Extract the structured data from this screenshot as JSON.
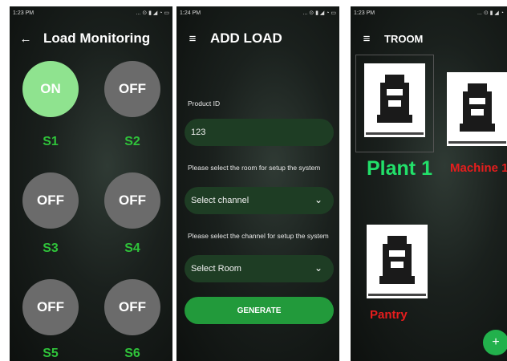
{
  "screen1": {
    "status_time": "1:23 PM",
    "status_icons": "... ⊙ ▮ ◢ ◔ ▭",
    "title": "Load Monitoring",
    "switches": [
      {
        "state": "ON",
        "label": "S1"
      },
      {
        "state": "OFF",
        "label": "S2"
      },
      {
        "state": "OFF",
        "label": "S3"
      },
      {
        "state": "OFF",
        "label": "S4"
      },
      {
        "state": "OFF",
        "label": "S5"
      },
      {
        "state": "OFF",
        "label": "S6"
      }
    ],
    "colors": {
      "on": "#8fe38f",
      "off": "#6b6b6b",
      "label": "#2fc33a"
    }
  },
  "screen2": {
    "status_time": "1:24 PM",
    "status_icons": "... ⊙ ▮ ◢ ◔ ▭",
    "title": "ADD LOAD",
    "product_id_label": "Product ID",
    "product_id_value": "123",
    "room_prompt": "Please select the room for setup the system",
    "channel_select": "Select channel",
    "channel_prompt": "Please select the channel for setup the system",
    "room_select": "Select Room",
    "generate_label": "GENERATE"
  },
  "screen3": {
    "status_time": "1:23 PM",
    "status_icons": "... ⊙ ▮ ◢ ◔",
    "title": "TROOM",
    "rooms": [
      {
        "label": "Plant 1",
        "color": "#22e06a"
      },
      {
        "label": "Machine 1",
        "color": "#e51d1d"
      },
      {
        "label": "Pantry",
        "color": "#e51d1d"
      }
    ],
    "fab_label": "+"
  }
}
